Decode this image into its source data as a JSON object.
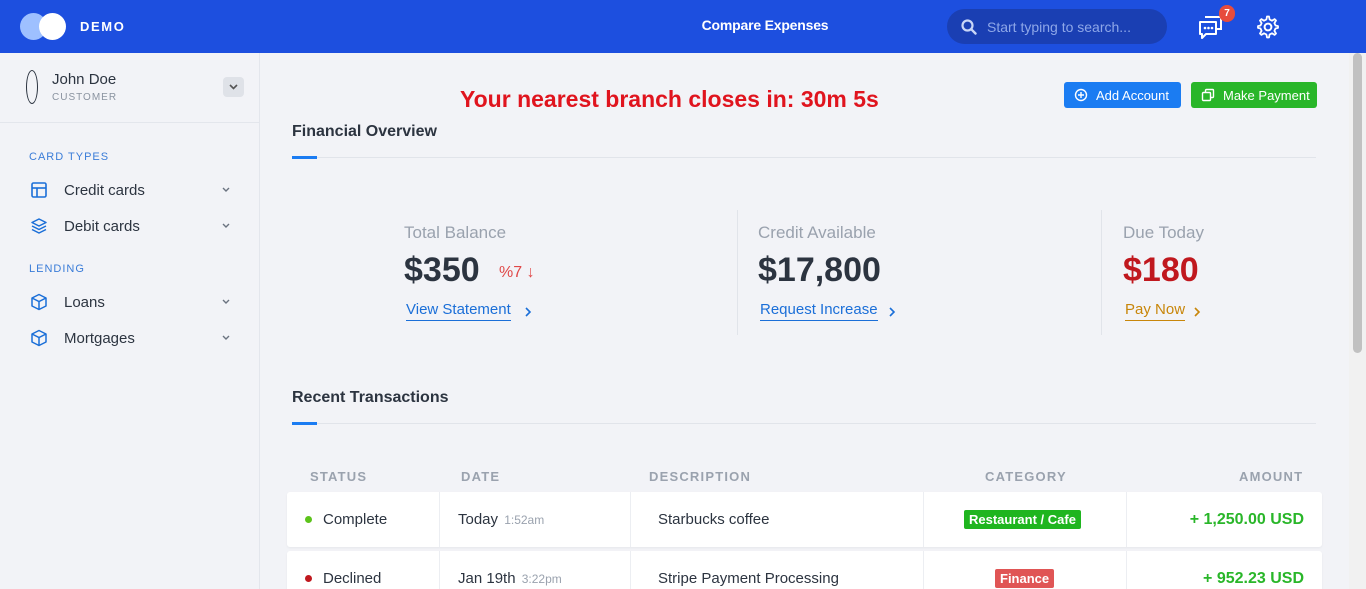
{
  "header": {
    "brand": "DEMO",
    "title": "Compare Expenses",
    "search_placeholder": "Start typing to search...",
    "notification_count": "7",
    "colors": {
      "bar": "#1d4fdf",
      "badge": "#e74c3c"
    }
  },
  "sidebar": {
    "user": {
      "name": "John Doe",
      "role": "CUSTOMER"
    },
    "sections": [
      {
        "title": "CARD TYPES",
        "items": [
          {
            "label": "Credit cards",
            "icon": "layout-icon"
          },
          {
            "label": "Debit cards",
            "icon": "layers-icon"
          }
        ]
      },
      {
        "title": "LENDING",
        "items": [
          {
            "label": "Loans",
            "icon": "box-icon"
          },
          {
            "label": "Mortgages",
            "icon": "box-icon"
          }
        ]
      }
    ]
  },
  "main": {
    "countdown": "Your nearest branch closes in: 30m 5s",
    "actions": {
      "add_account": "Add Account",
      "make_payment": "Make Payment"
    },
    "overview": {
      "title": "Financial Overview",
      "stats": [
        {
          "label": "Total Balance",
          "value": "$350",
          "change": "%7",
          "change_icon": "arrow-down-icon",
          "link": "View Statement",
          "link_color": "#1b6fd8"
        },
        {
          "label": "Credit Available",
          "value": "$17,800",
          "link": "Request Increase",
          "link_color": "#1b6fd8"
        },
        {
          "label": "Due Today",
          "value": "$180",
          "value_color": "#c0181e",
          "link": "Pay Now",
          "link_color": "#c8860a"
        }
      ]
    },
    "transactions": {
      "title": "Recent Transactions",
      "columns": [
        "STATUS",
        "DATE",
        "DESCRIPTION",
        "CATEGORY",
        "AMOUNT"
      ],
      "rows": [
        {
          "status": "Complete",
          "status_color": "#5cc31b",
          "date": "Today",
          "time": "1:52am",
          "description": "Starbucks coffee",
          "category": "Restaurant / Cafe",
          "category_color": "#1fb51f",
          "amount": "+ 1,250.00 USD"
        },
        {
          "status": "Declined",
          "status_color": "#c0181e",
          "date": "Jan 19th",
          "time": "3:22pm",
          "description": "Stripe Payment Processing",
          "category": "Finance",
          "category_color": "#e05555",
          "amount": "+ 952.23 USD"
        }
      ]
    }
  }
}
